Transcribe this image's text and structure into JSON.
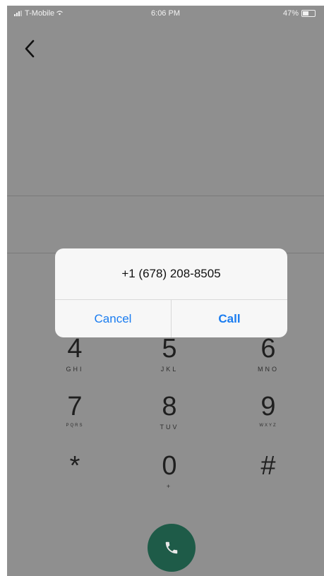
{
  "status_bar": {
    "carrier": "T-Mobile",
    "time": "6:06 PM",
    "battery": "47%",
    "battery_level": 0.47
  },
  "icons": {
    "back": "chevron-left-icon",
    "call": "phone-icon",
    "wifi": "wifi-icon",
    "signal": "signal-icon",
    "battery": "battery-icon"
  },
  "dialog": {
    "number": "+1 (678) 208-8505",
    "cancel_label": "Cancel",
    "call_label": "Call"
  },
  "keypad": {
    "keys": [
      {
        "digit": "4",
        "letters": "GHI"
      },
      {
        "digit": "5",
        "letters": "JKL"
      },
      {
        "digit": "6",
        "letters": "MNO"
      },
      {
        "digit": "7",
        "letters": "PQRS"
      },
      {
        "digit": "8",
        "letters": "TUV"
      },
      {
        "digit": "9",
        "letters": "WXYZ"
      },
      {
        "digit": "*",
        "letters": ""
      },
      {
        "digit": "0",
        "letters": "+"
      },
      {
        "digit": "#",
        "letters": ""
      }
    ]
  },
  "colors": {
    "overlay": "#8f8f8f",
    "call_button": "#1e5b48",
    "dialog_accent": "#1a7cf0"
  }
}
